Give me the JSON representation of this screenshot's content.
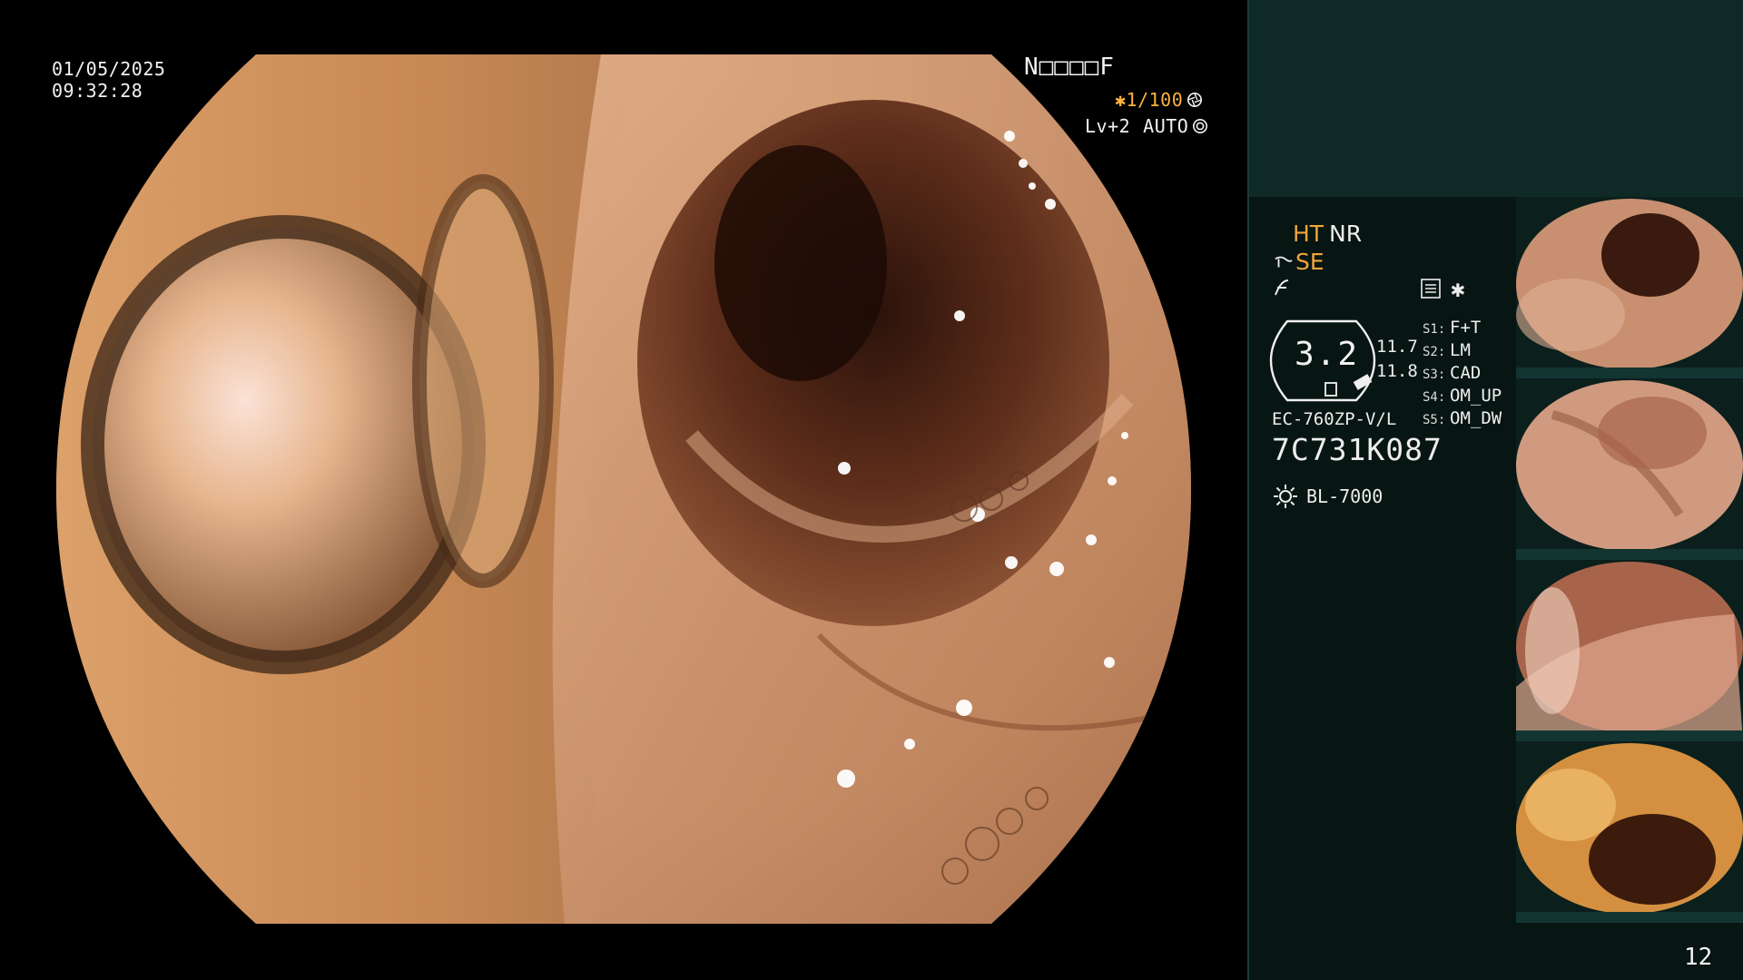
{
  "osd": {
    "date": "01/05/2025",
    "time": "09:32:28",
    "code": "N□□□□F",
    "shutter": "✱1/100",
    "level": "Lv+2",
    "auto": "AUTO"
  },
  "modes": {
    "ht": "HT",
    "nr": "NR",
    "se": "SE"
  },
  "asterisk": "✱",
  "dial": {
    "value": "3.2",
    "value1": "11.7",
    "value2": "11.8"
  },
  "settings": [
    {
      "key": "S1:",
      "value": "F+T"
    },
    {
      "key": "S2:",
      "value": "LM"
    },
    {
      "key": "S3:",
      "value": "CAD"
    },
    {
      "key": "S4:",
      "value": "OM_UP"
    },
    {
      "key": "S5:",
      "value": "OM_DW"
    }
  ],
  "device": {
    "model": "EC-760ZP-V/L",
    "serial": "7C731K087",
    "light_source": "BL-7000"
  },
  "page_number": "12",
  "colors": {
    "accent_orange": "#f0a53a",
    "panel_top": "#0f2a26",
    "panel_bottom": "#071513"
  },
  "icons": [
    "shutter-icon",
    "auto-iris-icon",
    "gesture-icon",
    "menu-icon",
    "light-source-icon"
  ]
}
